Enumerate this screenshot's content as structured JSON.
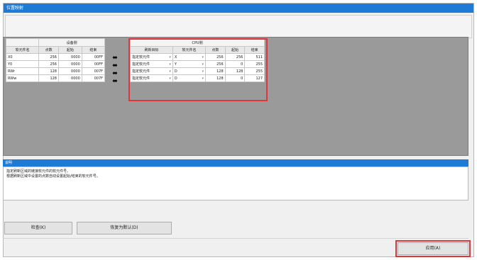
{
  "window": {
    "title": "位置映射"
  },
  "device_side": {
    "group": "设备侧",
    "headers": [
      "软元件名",
      "点数",
      "起始",
      "结束"
    ],
    "rows": [
      [
        "X0",
        "256",
        "0000",
        "00FF"
      ],
      [
        "Y0",
        "256",
        "0000",
        "00FF"
      ],
      [
        "RWr",
        "128",
        "0000",
        "007F"
      ],
      [
        "RWw",
        "128",
        "0000",
        "007F"
      ]
    ]
  },
  "cpu_side": {
    "group": "CPU侧",
    "headers": [
      "刷新目标",
      "软元件名",
      "点数",
      "起始",
      "结束"
    ],
    "rows": [
      [
        "指定软元件",
        "X",
        "256",
        "256",
        "511"
      ],
      [
        "指定软元件",
        "Y",
        "256",
        "0",
        "255"
      ],
      [
        "指定软元件",
        "D",
        "128",
        "128",
        "255"
      ],
      [
        "指定软元件",
        "D",
        "128",
        "0",
        "127"
      ]
    ]
  },
  "transfer_icon": "double-arrow-icon",
  "description": {
    "title": "说明",
    "lines": [
      "指定刷新区域的链接软元件的软元件号。",
      "根据刷新区域中设置的点数自动设置起始/结束的软元件号。"
    ]
  },
  "buttons": {
    "check": "检查(K)",
    "config": "恢复为默认(D)",
    "apply": "应用(A)"
  },
  "colors": {
    "title_bar": "#1d7bd6",
    "highlight": "#e0363b",
    "grid_bg": "#9a9a9a"
  }
}
